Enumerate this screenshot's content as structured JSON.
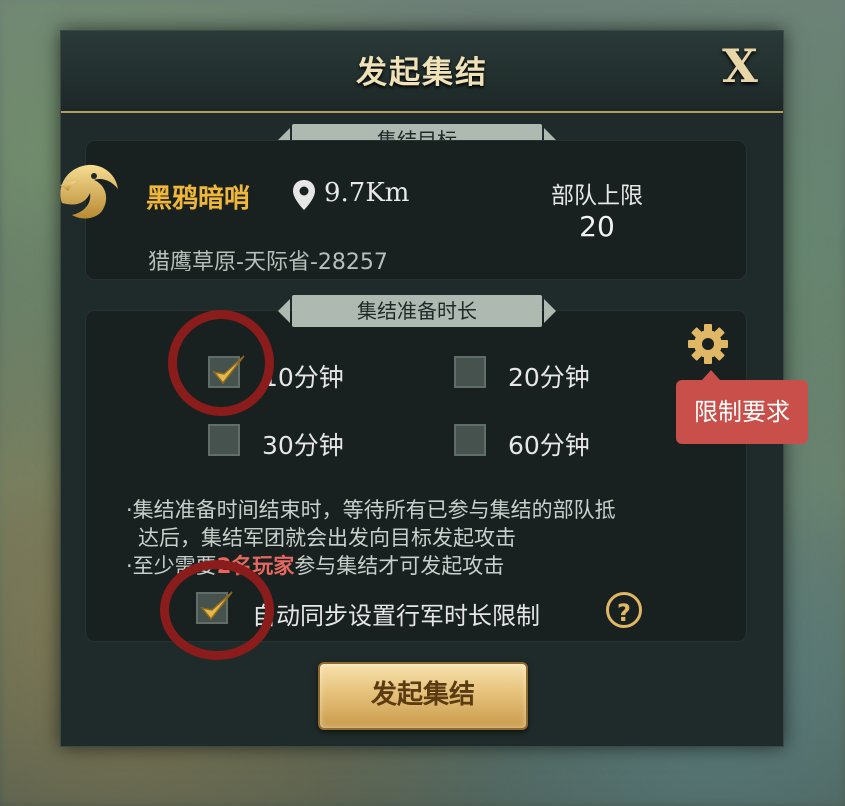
{
  "dialog": {
    "title": "发起集结",
    "close_label": "X"
  },
  "target_section": {
    "label": "集结目标",
    "name": "黑鸦暗哨",
    "distance": "9.7Km",
    "location": "猎鹰草原-天际省-28257",
    "troop_cap_label": "部队上限",
    "troop_cap_value": "20"
  },
  "prep_section": {
    "label": "集结准备时长",
    "options": [
      {
        "label": "10分钟",
        "checked": true
      },
      {
        "label": "20分钟",
        "checked": false
      },
      {
        "label": "30分钟",
        "checked": false
      },
      {
        "label": "60分钟",
        "checked": false
      }
    ],
    "restriction_tooltip": "限制要求",
    "note_line1": "·集结准备时间结束时，等待所有已参与集结的部队抵",
    "note_line2": "达后，集结军团就会出发向目标发起攻击",
    "note3_prefix": "·至少需要",
    "note3_highlight": "2名玩家",
    "note3_suffix": "参与集结才可发起攻击",
    "auto_sync_label": "自动同步设置行军时长限制",
    "auto_sync_checked": true,
    "help_label": "?"
  },
  "footer": {
    "launch_button": "发起集结"
  },
  "colors": {
    "accent_gold": "#f0b73a",
    "highlight_red": "#e8675f",
    "annotation_ring": "#8a1c1c"
  }
}
